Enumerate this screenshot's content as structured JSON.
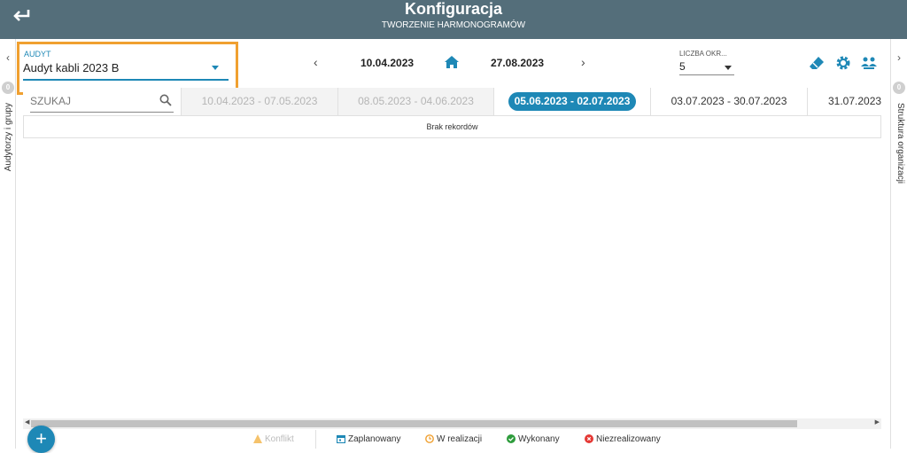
{
  "header": {
    "title": "Konfiguracja",
    "subtitle": "TWORZENIE HARMONOGRAMÓW",
    "accent": "#546e7a"
  },
  "sidebar_left": {
    "badge": "0",
    "label": "Audytorzy i grupy"
  },
  "sidebar_right": {
    "badge": "0",
    "label": "Struktura organizacji"
  },
  "audit_select": {
    "label": "AUDYT",
    "value": "Audyt kabli 2023 B"
  },
  "date_nav": {
    "from": "10.04.2023",
    "to": "27.08.2023"
  },
  "periods_select": {
    "label": "LICZBA OKR...",
    "value": "5"
  },
  "toolbar": {
    "icons": [
      "eraser-icon",
      "settings-icon",
      "users-icon"
    ]
  },
  "grid": {
    "search_placeholder": "SZUKAJ",
    "periods": [
      {
        "label": "10.04.2023 - 07.05.2023",
        "state": "past"
      },
      {
        "label": "08.05.2023 - 04.06.2023",
        "state": "past"
      },
      {
        "label": "05.06.2023 - 02.07.2023",
        "state": "current"
      },
      {
        "label": "03.07.2023 - 30.07.2023",
        "state": "future"
      },
      {
        "label": "31.07.2023",
        "state": "future"
      }
    ],
    "empty_text": "Brak rekordów"
  },
  "legend": {
    "conflict": "Konflikt",
    "planned": "Zaplanowany",
    "in_progress": "W realizacji",
    "done": "Wykonany",
    "not_done": "Niezrealizowany"
  },
  "colors": {
    "primary": "#1e88b6",
    "highlight": "#f0a030",
    "done": "#2e9c3c",
    "not_done": "#e53935",
    "in_progress": "#f0a030",
    "conflict": "#f5c26b"
  }
}
